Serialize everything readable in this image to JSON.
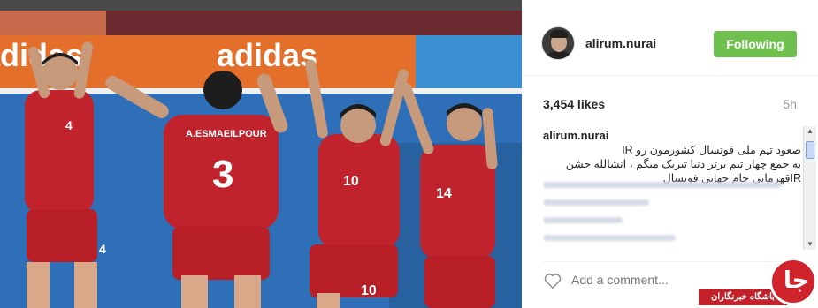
{
  "post": {
    "username": "alirum.nurai",
    "follow_label": "Following",
    "likes": "3,454 likes",
    "time": "5h",
    "caption_user": "alirum.nurai",
    "caption_line1": "صعود تیم ملی فوتسال کشورمون رو IR",
    "caption_line2": "به جمع چهار تیم برتر دنیا تبریک میگم ، انشالله جشن",
    "caption_line3": "IRقهرمانی جام جهانی فوتسال",
    "comment_placeholder": "Add a comment..."
  },
  "photo": {
    "banner_text": "adidas",
    "jersey_name": "A.ESMAEILPOUR",
    "numbers": [
      "4",
      "3",
      "10",
      "14",
      "4",
      "10"
    ]
  },
  "watermark": {
    "label": "باشگاه خبرنگاران",
    "glyph": "جا"
  },
  "colors": {
    "follow_green": "#70c050",
    "jersey_red": "#c0232b",
    "court_blue": "#2f6fb8"
  }
}
